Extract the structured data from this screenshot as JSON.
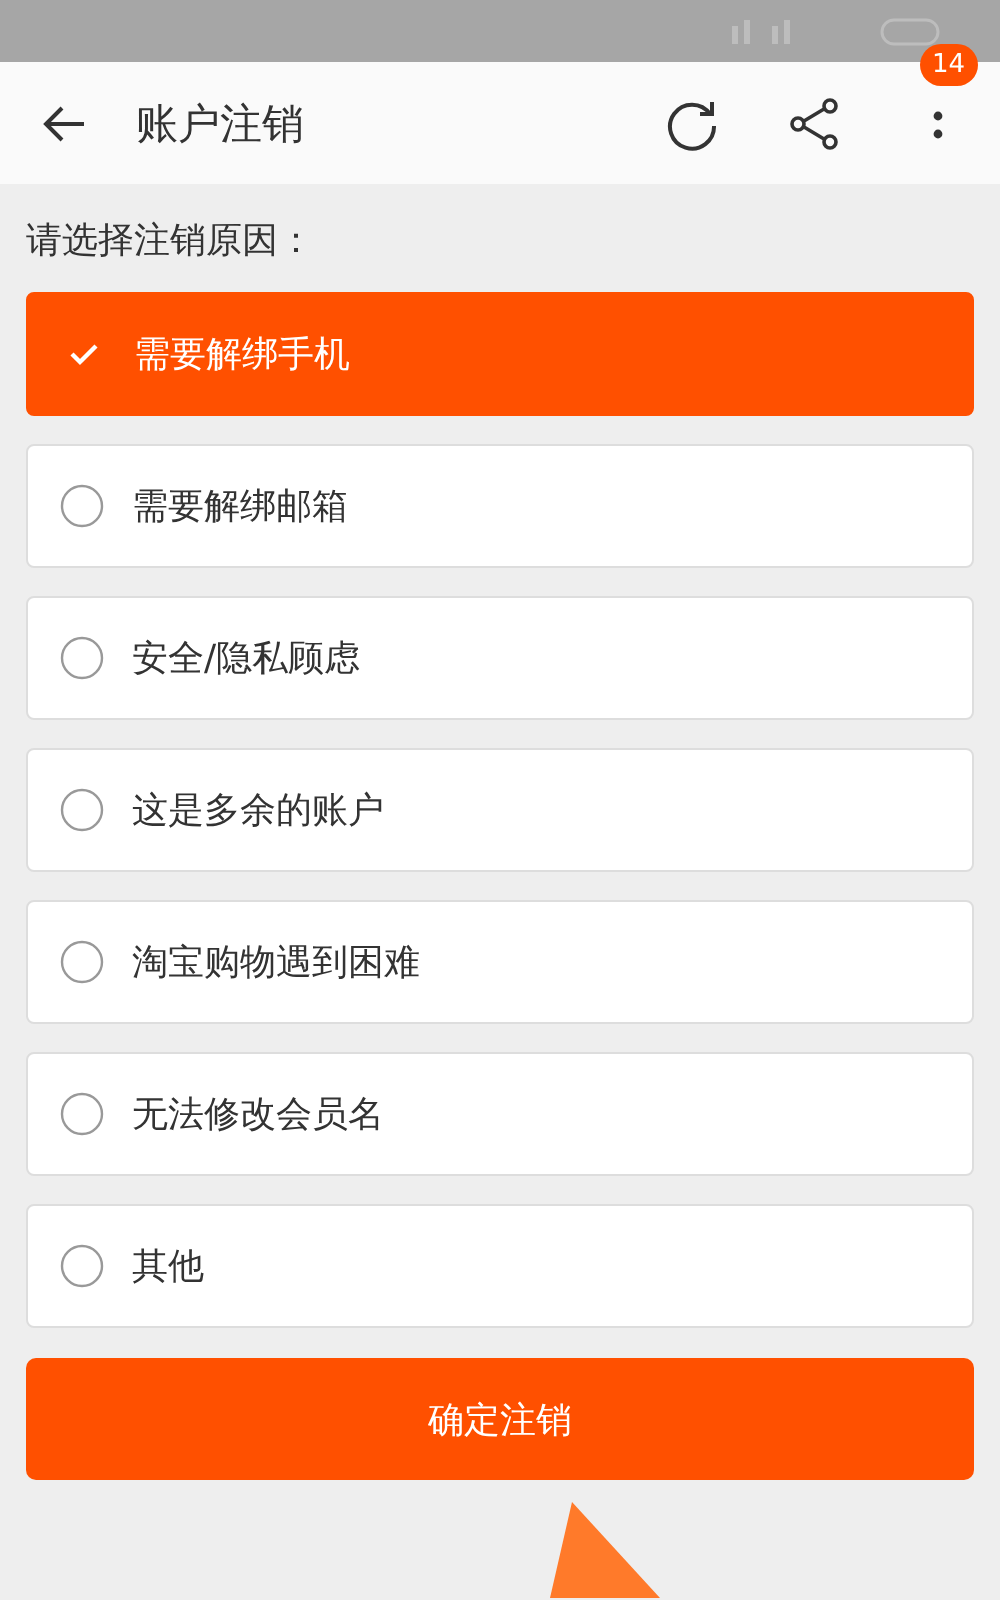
{
  "header": {
    "title": "账户注销",
    "badge": "14"
  },
  "prompt": "请选择注销原因：",
  "reasons": [
    {
      "label": "需要解绑手机",
      "selected": true
    },
    {
      "label": "需要解绑邮箱",
      "selected": false
    },
    {
      "label": "安全/隐私顾虑",
      "selected": false
    },
    {
      "label": "这是多余的账户",
      "selected": false
    },
    {
      "label": "淘宝购物遇到困难",
      "selected": false
    },
    {
      "label": "无法修改会员名",
      "selected": false
    },
    {
      "label": "其他",
      "selected": false
    }
  ],
  "confirm_button": "确定注销"
}
